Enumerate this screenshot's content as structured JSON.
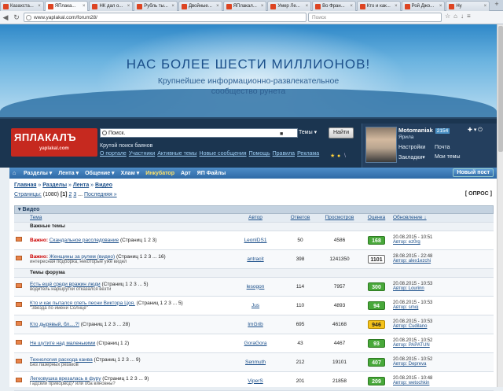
{
  "tabs": [
    "Казахста...",
    "ЯПлака...",
    "НК дал о...",
    "Рубль ты...",
    "Двойные...",
    "ЯПлакал...",
    "Умер Ле...",
    "Во Фран...",
    "Кто и как...",
    "Рой Джо...",
    "Ну"
  ],
  "browser": {
    "url": "www.yaplakal.com/forum28/",
    "search_placeholder": "Поиск"
  },
  "banner": {
    "headline": "НАС БОЛЕЕ ШЕСТИ МИЛЛИОНОВ!",
    "tagline1": "Крупнейшее информационно-развлекательное",
    "tagline2": "сообщество рунета"
  },
  "header": {
    "logo": "ЯПЛАКАЛЪ",
    "logo_sub": "yaplakal.com",
    "search_value": "Поиск.",
    "search_scope": "Темы",
    "search_button": "Найти",
    "tagline": "Крутой поиск баянов",
    "links": [
      "О портале",
      "Участники",
      "Активные темы",
      "Новые сообщения",
      "Помощь",
      "Правила",
      "Реклама"
    ]
  },
  "user": {
    "name": "Motomaniak",
    "badge": "2154",
    "role": "Ярила",
    "settings": "Настройки",
    "mail": "Почта",
    "bookmarks": "Закладки",
    "my_topics": "Мои темы"
  },
  "menu": {
    "items": [
      "Разделы",
      "Лента",
      "Общение",
      "Хлам",
      "Инкубатор",
      "Арт",
      "ЯП Файлы"
    ],
    "new_post": "Новый пост"
  },
  "breadcrumb": [
    "Главная",
    "Разделы",
    "Лента",
    "Видео"
  ],
  "pagination": {
    "label": "Страницы:",
    "total": "(1080)",
    "current": "[1]",
    "p2": "2",
    "p3": "3",
    "dots": "...",
    "last": "Последняя »"
  },
  "poll_label": "[ ОПРОС ]",
  "section_title": "Видео",
  "columns": [
    "Тема",
    "Автор",
    "Ответов",
    "Просмотров",
    "Оценка",
    "Обновление ↓"
  ],
  "group_important": "Важные темы",
  "group_forum": "Темы форума",
  "important_prefix": "Важно:",
  "topics": [
    {
      "important": true,
      "title": "Скандальное расследование",
      "pages": "(Страниц 1 2 3)",
      "sub": "",
      "author": "LeonIDS1",
      "replies": "50",
      "views": "4586",
      "rating": "168",
      "rcolor": "green",
      "date": "20.08.2015 - 10:51",
      "last": "Автор: ez0rg"
    },
    {
      "important": true,
      "title": "Женщины за рулем (видео)",
      "pages": "(Страниц 1 2 3 ... 16)",
      "sub": "интересная подборка, некоторые уже видел",
      "author": "antracit",
      "replies": "398",
      "views": "1241350",
      "rating": "1101",
      "rcolor": "white",
      "date": "28.08.2015 - 22:48",
      "last": "Автор: alex1ezchi"
    },
    {
      "important": false,
      "title": "Есть ещё среди вражин люди",
      "pages": "(Страниц 1 2 3 ... 5)",
      "sub": "водитель наршрутки отказался везти",
      "author": "lesogon",
      "replies": "114",
      "views": "7957",
      "rating": "300",
      "rcolor": "green",
      "date": "20.08.2015 - 10:53",
      "last": "Автор: Lourinn"
    },
    {
      "important": false,
      "title": "Кто и как пытался спеть песни Виктора Цоя.",
      "pages": "(Страниц 1 2 3 ... 5)",
      "sub": "\"Звезда по имени Солнце\"",
      "author": "Jus",
      "replies": "110",
      "views": "4893",
      "rating": "94",
      "rcolor": "green",
      "date": "20.08.2015 - 10:53",
      "last": "Автор: smoj"
    },
    {
      "important": false,
      "title": "Кто дырявый, бл....?!",
      "pages": "(Страниц 1 2 3 ... 28)",
      "sub": "",
      "author": "ImGrib",
      "replies": "695",
      "views": "46168",
      "rating": "946",
      "rcolor": "yellow",
      "date": "20.08.2015 - 10:53",
      "last": "Автор: Cudilano"
    },
    {
      "important": false,
      "title": "Не шутите над маленькими",
      "pages": "(Страниц 1 2)",
      "sub": "",
      "author": "GoraGora",
      "replies": "43",
      "views": "4467",
      "rating": "93",
      "rcolor": "green",
      "date": "20.08.2015 - 10:52",
      "last": "Автор: PAPATUN"
    },
    {
      "important": false,
      "title": "Технология расхода канва",
      "pages": "(Страниц 1 2 3 ... 9)",
      "sub": "Без лазерных резаков",
      "author": "Senmuth",
      "replies": "212",
      "views": "19101",
      "rating": "407",
      "rcolor": "green",
      "date": "20.08.2015 - 10:52",
      "last": "Автор: Depreva"
    },
    {
      "important": false,
      "title": "Легковушка врезалась в фуру",
      "pages": "(Страниц 1 2 3 ... 9)",
      "sub": "Гадский прикорвод? или оба виновны?",
      "author": "ViperS",
      "replies": "201",
      "views": "21858",
      "rating": "209",
      "rcolor": "green",
      "date": "20.08.2015 - 10:48",
      "last": "Автор: wetochkin"
    }
  ]
}
